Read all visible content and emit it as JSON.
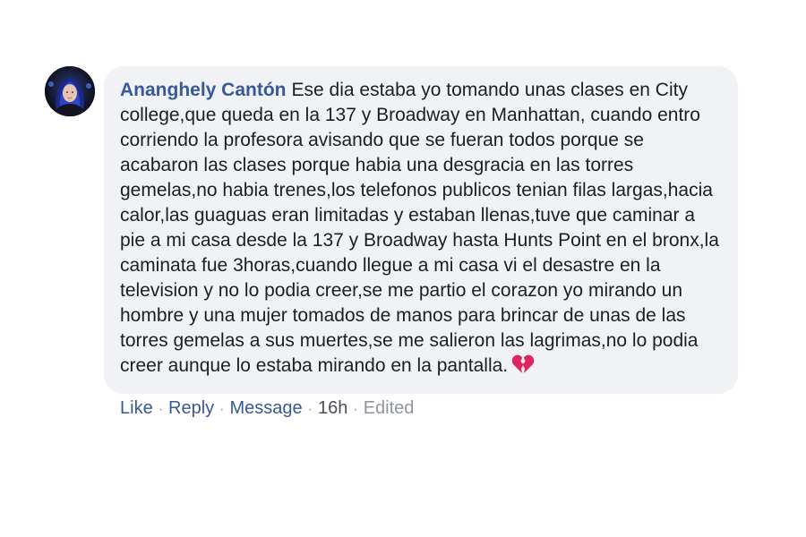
{
  "comment": {
    "author": "Ananghely Cantón",
    "text": "Ese dia estaba yo tomando unas clases en City college,que queda en la 137 y Broadway en Manhattan, cuando entro corriendo la profesora avisando que se fueran todos porque se acabaron las clases porque habia una desgracia en las torres gemelas,no habia trenes,los telefonos publicos tenian filas largas,hacia calor,las guaguas eran limitadas y estaban llenas,tuve que caminar a pie a mi casa desde la 137 y Broadway hasta Hunts Point en el bronx,la caminata fue 3horas,cuando llegue a mi casa vi el desastre en la television y no lo podia creer,se me partio el corazon yo mirando un hombre y una mujer tomados de manos para brincar de unas de las torres gemelas a sus muertes,se me salieron las lagrimas,no lo podia creer aunque lo estaba mirando en la pantalla.",
    "emoji": "broken-heart-icon"
  },
  "actions": {
    "like": "Like",
    "reply": "Reply",
    "message": "Message",
    "timestamp": "16h",
    "edited": "Edited",
    "separator": "·"
  },
  "colors": {
    "author": "#385898",
    "bubble_bg": "#f0f2f5",
    "text": "#1c1e21",
    "meta": "#90949c",
    "emoji": "#e0245e"
  }
}
